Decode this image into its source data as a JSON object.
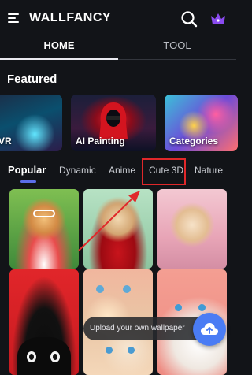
{
  "header": {
    "app_title": "WALLFANCY",
    "icons": {
      "menu": "menu-icon",
      "search": "search-icon",
      "premium": "crown-icon"
    },
    "crown_color": "#8a4bf0"
  },
  "top_tabs": [
    {
      "label": "HOME",
      "active": true
    },
    {
      "label": "TOOL",
      "active": false
    }
  ],
  "featured": {
    "title": "Featured",
    "cards": [
      {
        "label": "VR"
      },
      {
        "label": "AI Painting"
      },
      {
        "label": "Categories"
      }
    ]
  },
  "category_tabs": [
    {
      "label": "Popular",
      "active": true
    },
    {
      "label": "Dynamic",
      "active": false
    },
    {
      "label": "Anime",
      "active": false
    },
    {
      "label": "Cute 3D",
      "active": false,
      "highlighted": true
    },
    {
      "label": "Nature",
      "active": false
    }
  ],
  "upload": {
    "text": "Upload your own wallpaper",
    "icon": "cloud-upload-icon"
  },
  "colors": {
    "background": "#121418",
    "accent": "#4a7cf4",
    "highlight": "#e0282a",
    "tab_indicator": "#5b6ee8"
  }
}
